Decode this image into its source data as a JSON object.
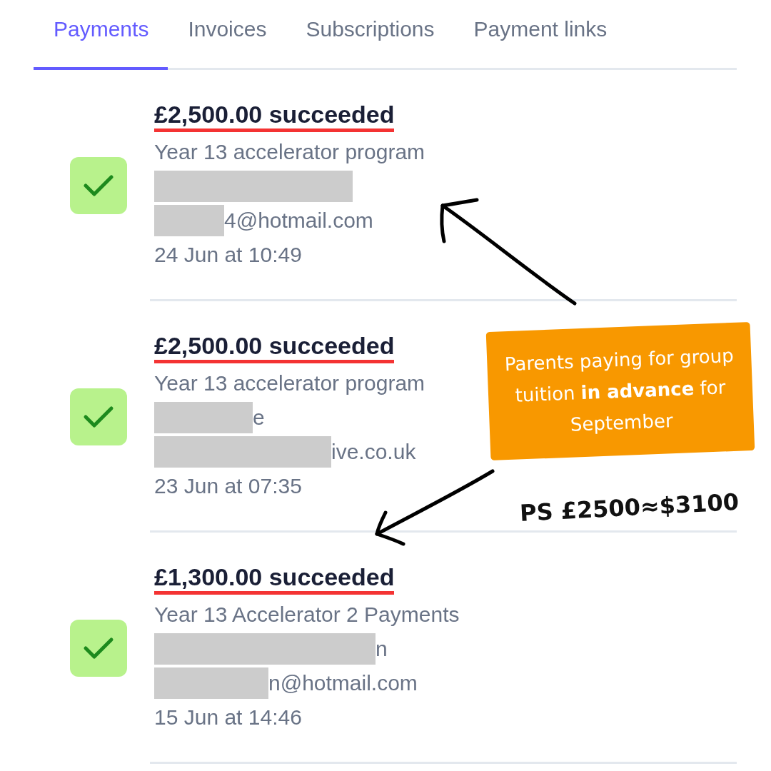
{
  "tabs": [
    {
      "label": "Payments",
      "selected": true
    },
    {
      "label": "Invoices",
      "selected": false
    },
    {
      "label": "Subscriptions",
      "selected": false
    },
    {
      "label": "Payment links",
      "selected": false
    }
  ],
  "payments": [
    {
      "amount": "£2,500.00 succeeded",
      "underlined": true,
      "description": "Year 13 accelerator program",
      "name": {
        "redacted": true
      },
      "email": {
        "redacted": true,
        "text": "4@hotmail.com"
      },
      "date": "24 Jun at 10:49"
    },
    {
      "amount": "£2,500.00 succeeded",
      "underlined": true,
      "description": "Year 13 accelerator program",
      "name": {
        "redacted": true,
        "text": "e"
      },
      "email": {
        "redacted": true,
        "text": "ive.co.uk"
      },
      "date": "23 Jun at 07:35"
    },
    {
      "amount": "£1,300.00 succeeded",
      "underlined": true,
      "description": "Year 13 Accelerator 2 Payments",
      "name": {
        "redacted": true,
        "text": "n"
      },
      "email": {
        "redacted": true,
        "text": "n@hotmail.com"
      },
      "date": "15 Jun at 14:46"
    }
  ],
  "annotation": {
    "callout": "Parents paying for group tuition **in advance** for September",
    "note": "PS £2500≈$3100"
  }
}
